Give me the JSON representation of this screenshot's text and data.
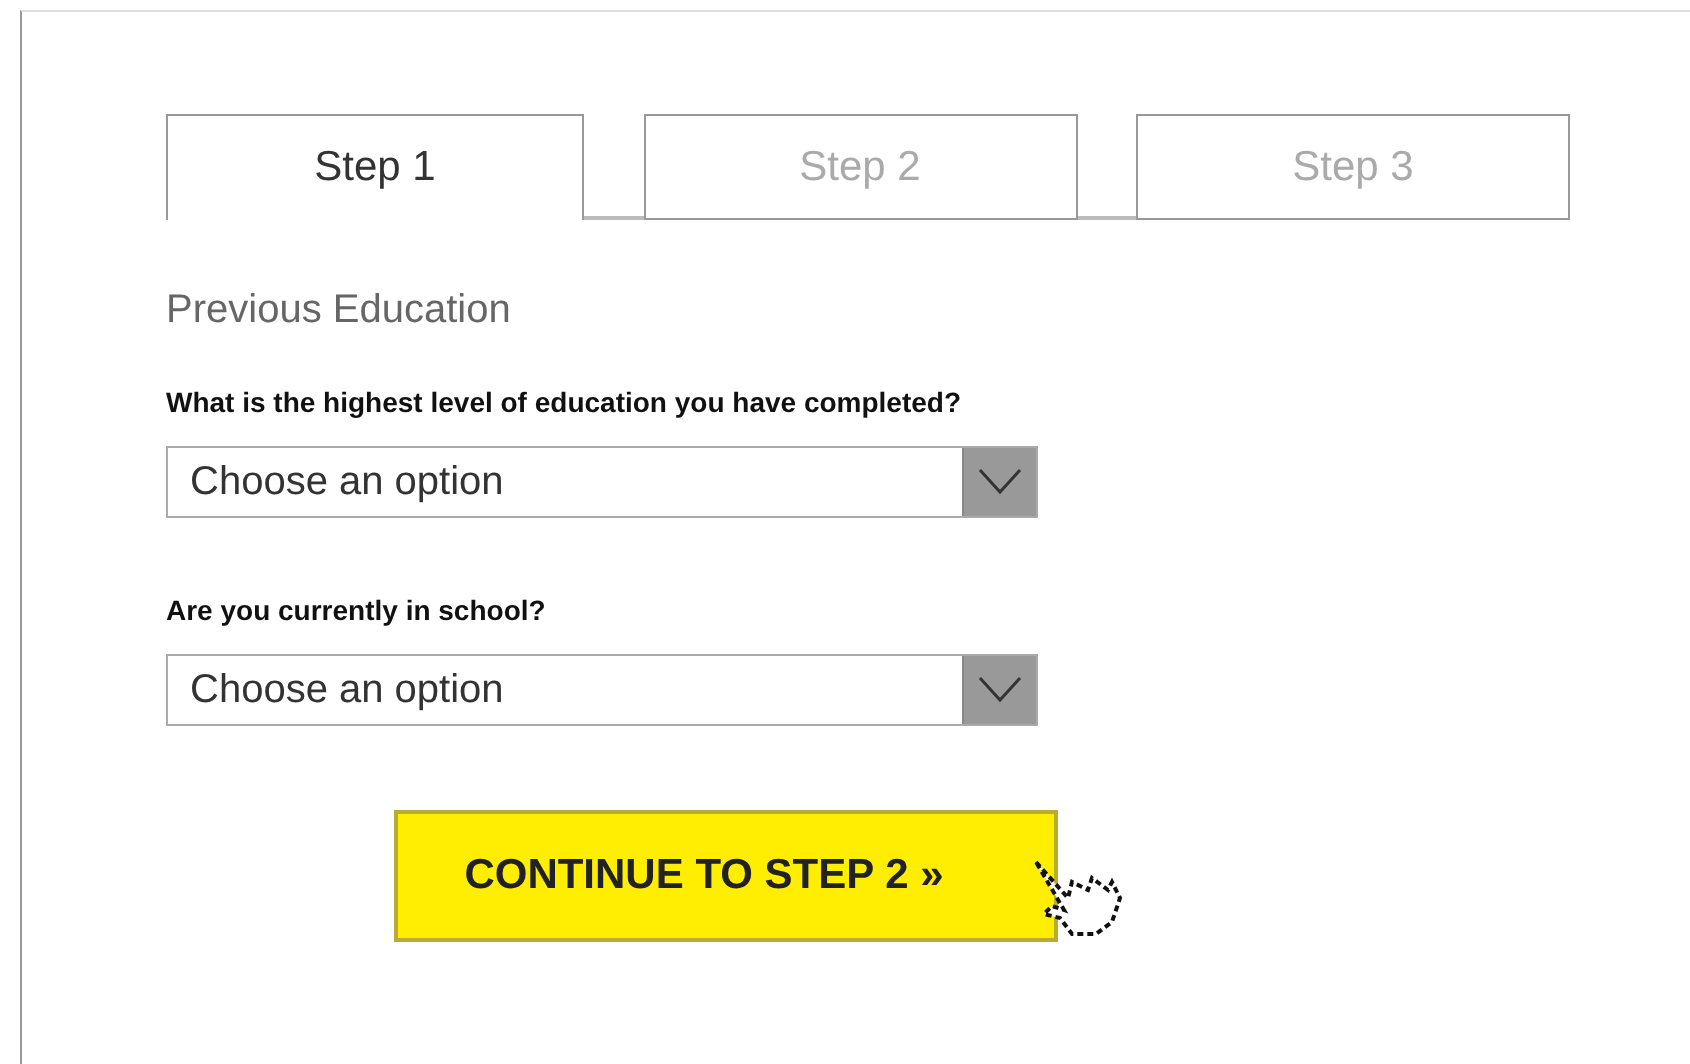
{
  "tabs": [
    {
      "label": "Step 1",
      "selected": true
    },
    {
      "label": "Step 2",
      "selected": false
    },
    {
      "label": "Step 3",
      "selected": false
    }
  ],
  "section_title": "Previous Education",
  "questions": [
    {
      "label": "What is the highest level of education you have completed?",
      "placeholder": "Choose an option"
    },
    {
      "label": "Are you currently in school?",
      "placeholder": "Choose an option"
    }
  ],
  "continue_button": "CONTINUE TO STEP 2 »"
}
